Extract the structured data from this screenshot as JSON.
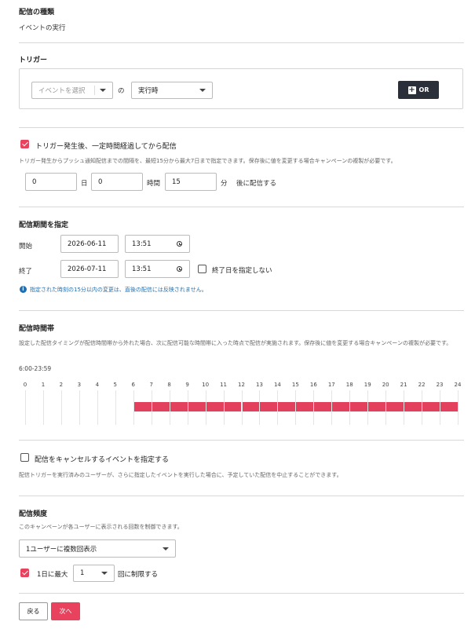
{
  "delivery_type": {
    "heading": "配信の種類",
    "value": "イベントの実行"
  },
  "trigger": {
    "heading": "トリガー",
    "event_select_placeholder": "イベントを選択",
    "connector": "の",
    "timing_select_value": "実行時",
    "or_button_label": "OR"
  },
  "delay": {
    "checkbox_label": "トリガー発生後、一定時間経過してから配信",
    "checked": true,
    "note": "トリガー発生からプッシュ通知配信までの間隔を、最短15分から最大7日まで指定できます。保存後に値を変更する場合キャンペーンの複製が必要です。",
    "days_value": "0",
    "days_unit": "日",
    "hours_value": "0",
    "hours_unit": "時間",
    "minutes_value": "15",
    "minutes_unit": "分",
    "suffix": "後に配信する"
  },
  "period": {
    "heading": "配信期間を指定",
    "start_label": "開始",
    "start_date": "2026-06-11",
    "start_time": "13:51",
    "end_label": "終了",
    "end_date": "2026-07-11",
    "end_time": "13:51",
    "no_end_label": "終了日を指定しない",
    "no_end_checked": false,
    "info": "指定された時刻の15分以内の変更は、直後の配信には反映されません。"
  },
  "time_window": {
    "heading": "配信時間帯",
    "note": "設定した配信タイミングが配信時間帯から外れた場合、次に配信可能な時間帯に入った時点で配信が実施されます。保存後に値を変更する場合キャンペーンの複製が必要です。",
    "range_label": "6:00-23:59",
    "hours": [
      "0",
      "1",
      "2",
      "3",
      "4",
      "5",
      "6",
      "7",
      "8",
      "9",
      "10",
      "11",
      "12",
      "13",
      "14",
      "15",
      "16",
      "17",
      "18",
      "19",
      "20",
      "21",
      "22",
      "23",
      "24"
    ],
    "active_start_hour": 6,
    "active_end_hour": 24,
    "bar_color": "#e2405c"
  },
  "cancel_event": {
    "checkbox_label": "配信をキャンセルするイベントを指定する",
    "checked": false,
    "note": "配信トリガーを実行済みのユーザーが、さらに指定したイベントを実行した場合に、予定していた配信を中止することができます。"
  },
  "frequency": {
    "heading": "配信頻度",
    "note": "このキャンペーンが各ユーザーに表示される回数を制御できます。",
    "mode_value": "1ユーザーに複数回表示",
    "limit_checked": true,
    "limit_prefix": "1日に最大",
    "limit_value": "1",
    "limit_suffix": "回に制限する"
  },
  "footer": {
    "back_label": "戻る",
    "next_label": "次へ"
  },
  "colors": {
    "accent": "#e8425f",
    "dark_button": "#2a2f3a",
    "info_blue": "#1f6fb2"
  }
}
